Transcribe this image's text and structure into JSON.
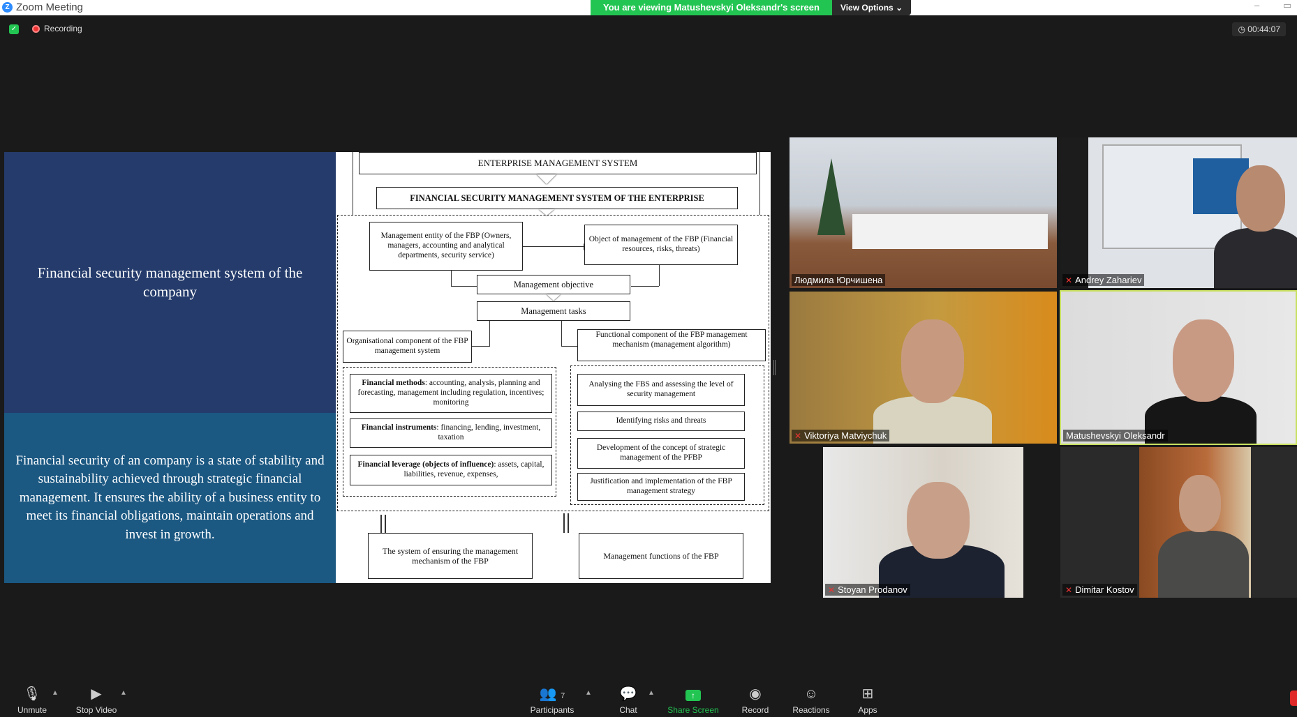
{
  "window": {
    "app_title": "Zoom Meeting",
    "min": "–",
    "max": "▭"
  },
  "banner": {
    "message": "You are viewing Matushevskyi Oleksandr's screen",
    "view_options": "View Options"
  },
  "status": {
    "recording": "Recording",
    "timer": "00:44:07"
  },
  "slide": {
    "title": "Financial security management system of the company",
    "description": "Financial security of an company is a state of stability and sustainability achieved through strategic financial management. It ensures the ability of a business entity to meet its financial obligations, maintain operations and invest in growth.",
    "diagram": {
      "enterprise": "ENTERPRISE MANAGEMENT SYSTEM",
      "fsms": "FINANCIAL SECURITY MANAGEMENT SYSTEM OF THE ENTERPRISE",
      "entity": "Management entity of the FBP (Owners, managers, accounting and analytical departments, security service)",
      "object": "Object of management of the FBP (Financial resources, risks, threats)",
      "objective": "Management objective",
      "tasks": "Management tasks",
      "org": "Organisational component of the FBP management system",
      "func": "Functional component of the FBP management mechanism (management algorithm)",
      "methods_bold": "Financial methods",
      "methods": ": accounting, analysis, planning and forecasting, management including regulation, incentives; monitoring",
      "instruments_bold": "Financial instruments",
      "instruments": ": financing, lending, investment, taxation",
      "leverage_bold": "Financial leverage (objects of influence)",
      "leverage": ": assets, capital, liabilities, revenue, expenses,",
      "analysing": "Analysing the FBS and assessing the level of security management",
      "identifying": "Identifying risks and threats",
      "development": "Development of the concept of strategic management of the PFBP",
      "justification": "Justification and implementation of the FBP management strategy",
      "ensuring": "The system of ensuring the management mechanism of the FBP",
      "functions": "Management functions of the FBP"
    }
  },
  "participants": [
    {
      "name": "Людмила Юрчишена",
      "muted": false
    },
    {
      "name": "Andrey Zahariev",
      "muted": true
    },
    {
      "name": "Viktoriya Matviychuk",
      "muted": true
    },
    {
      "name": "Matushevskyi Oleksandr",
      "muted": false
    },
    {
      "name": "Stoyan Prodanov",
      "muted": true
    },
    {
      "name": "Dimitar Kostov",
      "muted": true
    }
  ],
  "toolbar": {
    "unmute": "Unmute",
    "stop_video": "Stop Video",
    "participants": "Participants",
    "participants_count": "7",
    "chat": "Chat",
    "share_screen": "Share Screen",
    "record": "Record",
    "reactions": "Reactions",
    "apps": "Apps"
  },
  "colors": {
    "accent_green": "#23c552",
    "slide_top": "#243b6b",
    "slide_bottom": "#1b5882",
    "active_speaker": "#c8e060"
  }
}
